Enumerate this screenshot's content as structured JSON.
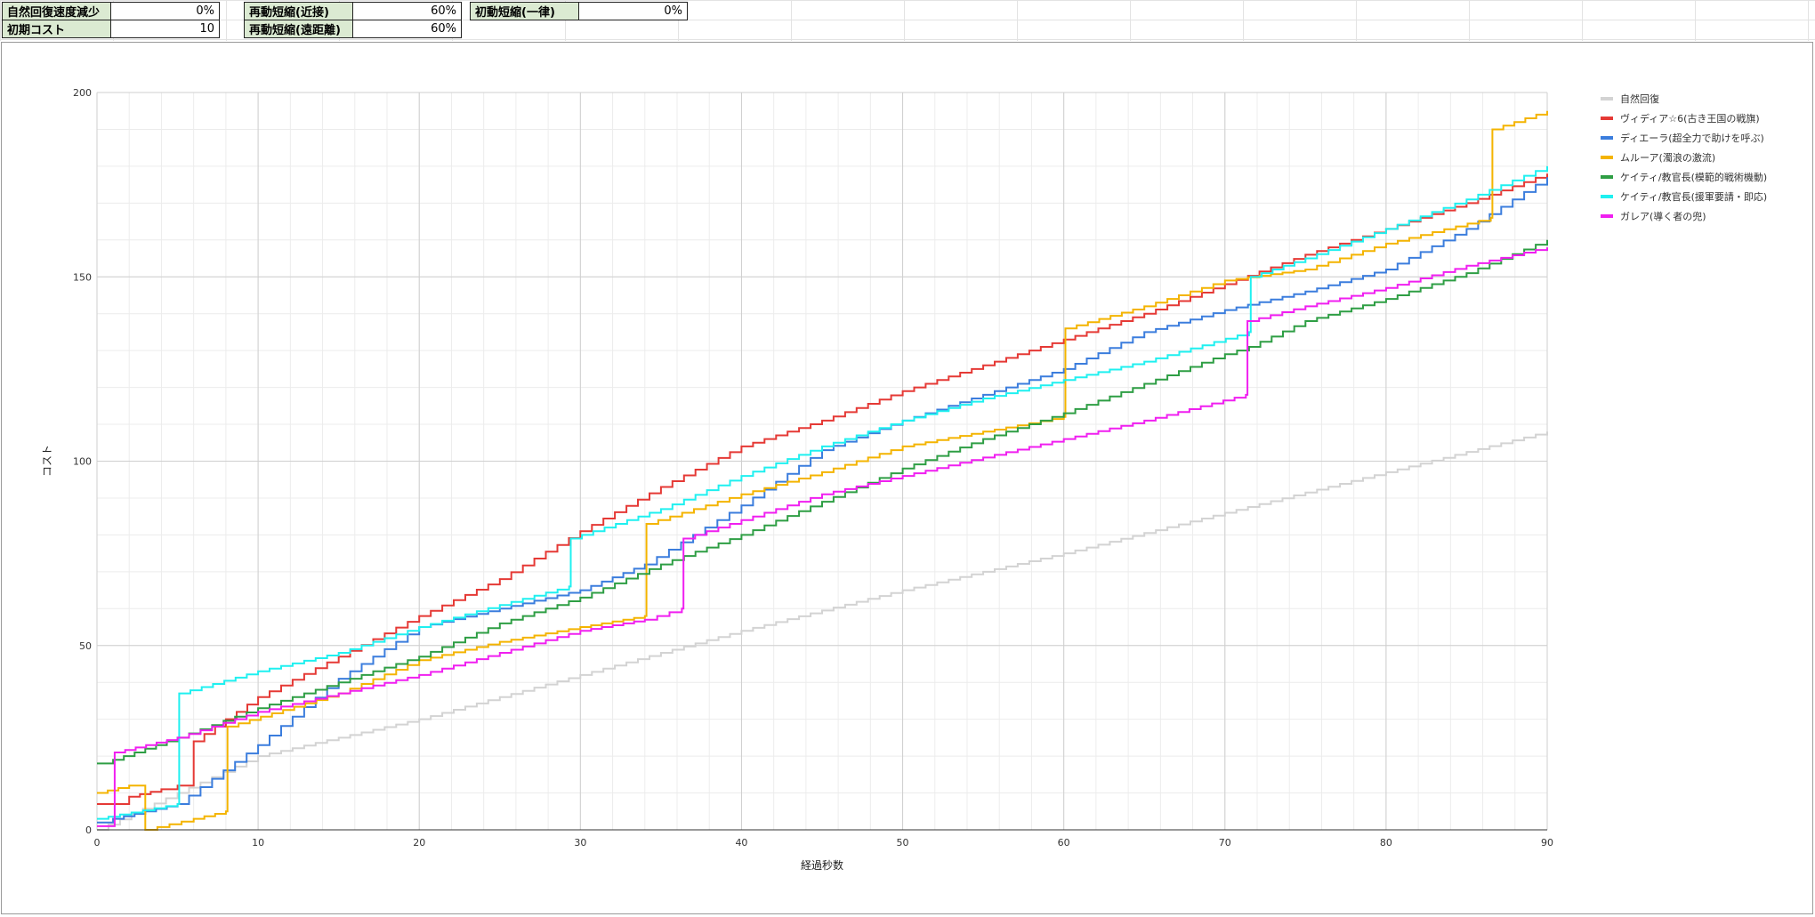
{
  "params": {
    "rows": [
      [
        {
          "label": "自然回復速度減少",
          "value": "0%"
        },
        {
          "label": "再動短縮(近接)",
          "value": "60%"
        },
        {
          "label": "初動短縮(一律)",
          "value": "0%"
        }
      ],
      [
        {
          "label": "初期コスト",
          "value": "10"
        },
        {
          "label": "再動短縮(遠距離)",
          "value": "60%"
        }
      ]
    ]
  },
  "chart_data": {
    "type": "line",
    "step": true,
    "xlabel": "経過秒数",
    "ylabel": "コスト",
    "xlim": [
      0,
      90
    ],
    "ylim": [
      0,
      200
    ],
    "xticks": [
      0,
      10,
      20,
      30,
      40,
      50,
      60,
      70,
      80,
      90
    ],
    "yticks": [
      0,
      50,
      100,
      150,
      200
    ],
    "grid": true,
    "legend_position": "right",
    "series": [
      {
        "name": "自然回復",
        "color": "#d3d3d3",
        "points": [
          [
            0,
            0
          ],
          [
            10,
            20
          ],
          [
            20,
            30
          ],
          [
            30,
            42
          ],
          [
            40,
            54
          ],
          [
            50,
            65
          ],
          [
            60,
            75
          ],
          [
            70,
            86
          ],
          [
            80,
            97
          ],
          [
            90,
            108
          ]
        ],
        "jumps": []
      },
      {
        "name": "ヴィディア☆6(古き王国の戦旗)",
        "color": "#e53935",
        "points": [
          [
            0,
            7
          ],
          [
            1,
            7
          ],
          [
            2,
            9
          ],
          [
            4,
            11
          ],
          [
            5,
            12
          ],
          [
            6,
            24
          ],
          [
            10,
            36
          ],
          [
            15,
            47
          ],
          [
            20,
            58
          ],
          [
            25,
            68
          ],
          [
            30,
            81
          ],
          [
            35,
            93
          ],
          [
            40,
            104
          ],
          [
            45,
            111
          ],
          [
            50,
            119
          ],
          [
            55,
            126
          ],
          [
            60,
            133
          ],
          [
            65,
            140
          ],
          [
            70,
            148
          ],
          [
            75,
            156
          ],
          [
            80,
            163
          ],
          [
            85,
            170
          ],
          [
            90,
            178
          ]
        ],
        "jumps": []
      },
      {
        "name": "ディエーラ(超全力で助けを呼ぶ)",
        "color": "#3b7ddd",
        "points": [
          [
            0,
            2
          ],
          [
            1,
            3
          ],
          [
            3,
            5
          ],
          [
            5,
            7
          ],
          [
            10,
            23
          ],
          [
            15,
            41
          ],
          [
            20,
            55
          ],
          [
            25,
            60
          ],
          [
            30,
            65
          ],
          [
            34,
            72
          ],
          [
            37,
            80
          ],
          [
            40,
            88
          ],
          [
            45,
            103
          ],
          [
            50,
            111
          ],
          [
            55,
            118
          ],
          [
            60,
            125
          ],
          [
            65,
            135
          ],
          [
            70,
            141
          ],
          [
            75,
            146
          ],
          [
            80,
            152
          ],
          [
            85,
            163
          ],
          [
            90,
            177
          ]
        ],
        "jumps": []
      },
      {
        "name": "ムルーア(濁浪の激流)",
        "color": "#f4b400",
        "points": [
          [
            0,
            10
          ],
          [
            2,
            12
          ],
          [
            3,
            0
          ],
          [
            6,
            3
          ],
          [
            8,
            5
          ],
          [
            8.1,
            28
          ],
          [
            15,
            37
          ],
          [
            20,
            46
          ],
          [
            25,
            51
          ],
          [
            30,
            55
          ],
          [
            34,
            58
          ],
          [
            34.1,
            83
          ],
          [
            40,
            91
          ],
          [
            45,
            97
          ],
          [
            50,
            104
          ],
          [
            55,
            108
          ],
          [
            60,
            112
          ],
          [
            60.1,
            136
          ],
          [
            65,
            142
          ],
          [
            70,
            149
          ],
          [
            75,
            152
          ],
          [
            80,
            159
          ],
          [
            86.5,
            166
          ],
          [
            86.6,
            190
          ],
          [
            90,
            195
          ]
        ],
        "jumps": []
      },
      {
        "name": "ケイティ/教官長(模範的戦術機動)",
        "color": "#2e9e44",
        "points": [
          [
            0,
            18
          ],
          [
            1,
            19
          ],
          [
            5,
            25
          ],
          [
            10,
            33
          ],
          [
            15,
            40
          ],
          [
            20,
            47
          ],
          [
            25,
            56
          ],
          [
            30,
            63
          ],
          [
            35,
            72
          ],
          [
            40,
            80
          ],
          [
            45,
            89
          ],
          [
            50,
            98
          ],
          [
            55,
            106
          ],
          [
            60,
            113
          ],
          [
            65,
            121
          ],
          [
            70,
            129
          ],
          [
            71.5,
            131
          ],
          [
            75,
            138
          ],
          [
            80,
            144
          ],
          [
            85,
            151
          ],
          [
            90,
            160
          ]
        ],
        "jumps": []
      },
      {
        "name": "ケイティ/教官長(援軍要請・即応)",
        "color": "#1ff0f0",
        "points": [
          [
            0,
            3
          ],
          [
            5,
            7
          ],
          [
            5.1,
            37
          ],
          [
            10,
            43
          ],
          [
            15,
            48
          ],
          [
            20,
            55
          ],
          [
            25,
            61
          ],
          [
            29.3,
            66
          ],
          [
            29.4,
            79
          ],
          [
            35,
            87
          ],
          [
            40,
            96
          ],
          [
            45,
            104
          ],
          [
            50,
            111
          ],
          [
            55,
            117
          ],
          [
            60,
            122
          ],
          [
            65,
            127
          ],
          [
            71.5,
            135
          ],
          [
            71.6,
            150
          ],
          [
            75,
            155
          ],
          [
            80,
            163
          ],
          [
            85,
            171
          ],
          [
            90,
            180
          ]
        ],
        "jumps": []
      },
      {
        "name": "ガレア(導く者の兜)",
        "color": "#f01ff0",
        "points": [
          [
            0,
            1
          ],
          [
            1,
            1
          ],
          [
            1.1,
            21
          ],
          [
            5,
            25
          ],
          [
            10,
            32
          ],
          [
            15,
            37
          ],
          [
            20,
            42
          ],
          [
            25,
            48
          ],
          [
            30,
            54
          ],
          [
            34,
            57
          ],
          [
            36.3,
            60
          ],
          [
            36.4,
            79
          ],
          [
            40,
            84
          ],
          [
            45,
            91
          ],
          [
            50,
            96
          ],
          [
            55,
            101
          ],
          [
            60,
            106
          ],
          [
            65,
            111
          ],
          [
            71.3,
            118
          ],
          [
            71.4,
            138
          ],
          [
            75,
            142
          ],
          [
            80,
            147
          ],
          [
            85,
            153
          ],
          [
            90,
            158
          ]
        ],
        "jumps": []
      }
    ]
  }
}
